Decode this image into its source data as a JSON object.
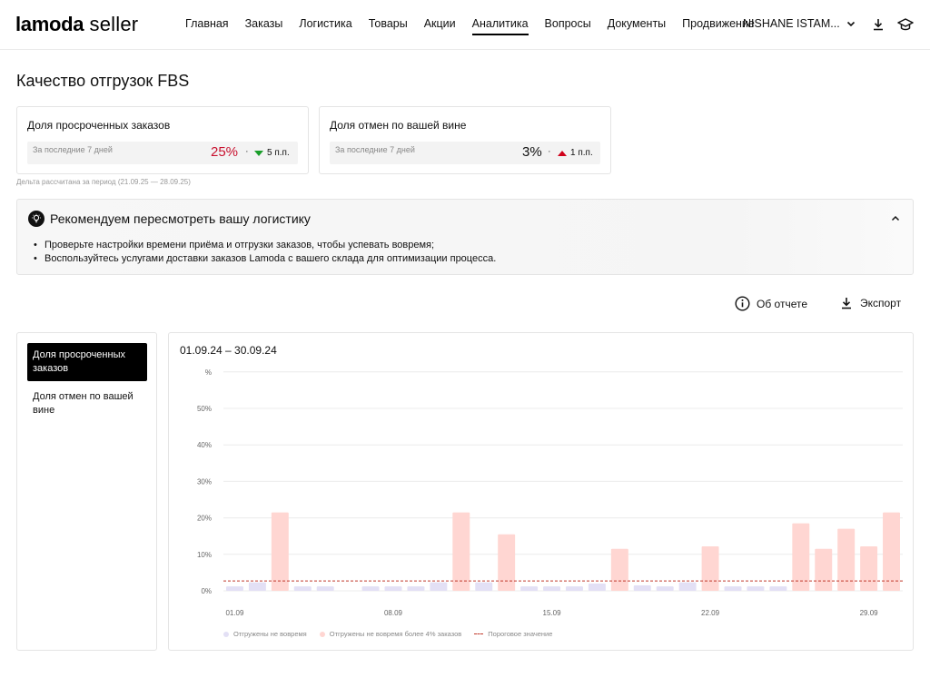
{
  "header": {
    "logo_brand": "lamoda",
    "logo_suffix": "seller",
    "nav": [
      "Главная",
      "Заказы",
      "Логистика",
      "Товары",
      "Акции",
      "Аналитика",
      "Вопросы",
      "Документы",
      "Продвижение"
    ],
    "active_nav": "Аналитика",
    "account": "NISHANE ISTAM..."
  },
  "page_title": "Качество отгрузок FBS",
  "metrics": [
    {
      "title": "Доля просроченных заказов",
      "period": "За последние 7 дней",
      "value": "25%",
      "value_color": "#c8102e",
      "delta": "5 п.п.",
      "delta_direction": "down"
    },
    {
      "title": "Доля отмен по вашей вине",
      "period": "За последние 7 дней",
      "value": "3%",
      "value_color": "#111111",
      "delta": "1 п.п.",
      "delta_direction": "up"
    }
  ],
  "delta_note": "Дельта рассчитана за период (21.09.25 — 28.09.25)",
  "recommendation": {
    "title": "Рекомендуем пересмотреть вашу логистику",
    "items": [
      "Проверьте настройки времени приёма и отгрузки заказов, чтобы успевать вовремя;",
      "Воспользуйтесь услугами доставки заказов Lamoda с вашего склада для оптимизации процесса."
    ]
  },
  "actions": {
    "about": "Об отчете",
    "export": "Экспорт"
  },
  "selector": {
    "items": [
      "Доля просроченных заказов",
      "Доля отмен по вашей вине"
    ],
    "active_index": 0
  },
  "chart_panel": {
    "date_range": "01.09.24 – 30.09.24"
  },
  "chart_data": {
    "type": "bar",
    "ylabel": "%",
    "y_ticks": [
      "0%",
      "10%",
      "20%",
      "30%",
      "40%",
      "50%"
    ],
    "ylim": [
      0,
      60
    ],
    "x_tick_labels": [
      "01.09",
      "08.09",
      "15.09",
      "22.09",
      "29.09"
    ],
    "x_tick_days": [
      1,
      8,
      15,
      22,
      29
    ],
    "days": [
      1,
      2,
      3,
      4,
      5,
      6,
      7,
      8,
      9,
      10,
      11,
      12,
      13,
      14,
      15,
      16,
      17,
      18,
      19,
      20,
      21,
      22,
      23,
      24,
      25,
      26,
      27,
      28,
      29,
      30
    ],
    "values": [
      1.2,
      2.3,
      21.5,
      1.2,
      1.2,
      0,
      1.2,
      1.2,
      1.2,
      2.3,
      21.5,
      2.3,
      15.5,
      1.2,
      1.2,
      1.2,
      2.0,
      11.5,
      1.5,
      1.2,
      2.3,
      12.2,
      1.2,
      1.2,
      1.2,
      18.5,
      11.5,
      17.0,
      12.2,
      21.5
    ],
    "threshold": 2.7,
    "threshold_over_threshold": 4,
    "colors": {
      "ok": "#e3e0f5",
      "over": "#ffd6d2",
      "threshold": "#c0392b",
      "grid": "#ececec",
      "axis_text": "#666666"
    },
    "legend": [
      "Отгружены не вовремя",
      "Отгружены не вовремя более 4% заказов",
      "Пороговое значение"
    ]
  }
}
